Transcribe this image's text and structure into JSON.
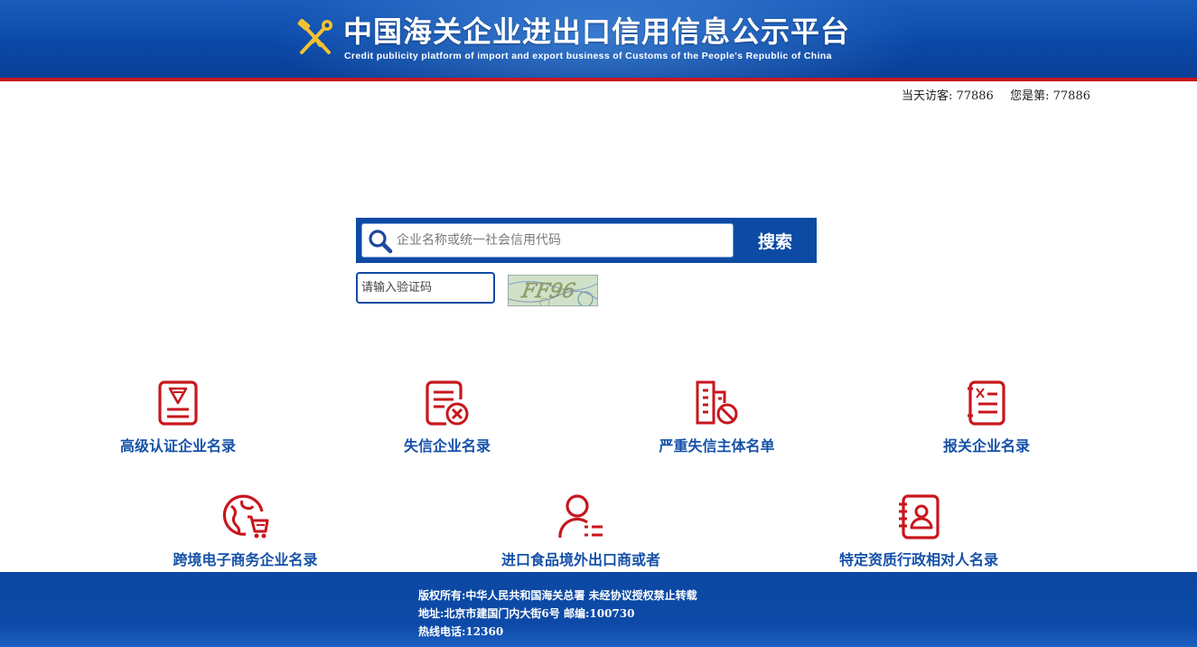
{
  "header": {
    "title": "中国海关企业进出口信用信息公示平台",
    "subtitle": "Credit publicity platform of import and export business of Customs of the People's Republic of China",
    "emblem_icon": "customs-emblem-icon"
  },
  "visitors": {
    "today_label": "当天访客:",
    "today_count": "77886",
    "you_are_label": "您是第:",
    "you_are_count": "77886"
  },
  "search": {
    "placeholder": "企业名称或统一社会信用代码",
    "value": "",
    "button_label": "搜索",
    "icon": "search-icon"
  },
  "captcha": {
    "placeholder": "请输入验证码",
    "value": "",
    "image_text": "FF96"
  },
  "categories": [
    {
      "label": "高级认证企业名录",
      "icon": "certified-list-icon"
    },
    {
      "label": "失信企业名录",
      "icon": "discredit-list-icon"
    },
    {
      "label": "严重失信主体名单",
      "icon": "serious-discredit-icon"
    },
    {
      "label": "报关企业名录",
      "icon": "customs-broker-list-icon"
    },
    {
      "label": "跨境电子商务企业名录",
      "icon": "cross-border-ecommerce-icon"
    },
    {
      "label": "进口食品境外出口商或者",
      "icon": "food-exporter-icon"
    },
    {
      "label": "特定资质行政相对人名录",
      "icon": "qualified-counterpart-icon"
    }
  ],
  "footer": {
    "copyright": "版权所有:中华人民共和国海关总署 未经协议授权禁止转载",
    "address": "地址:北京市建国门内大街6号 邮编:100730",
    "hotline": "热线电话:12360"
  },
  "colors": {
    "brand_blue": "#0d4aa4",
    "accent_red": "#c8161d",
    "label_blue": "#1551a8"
  }
}
